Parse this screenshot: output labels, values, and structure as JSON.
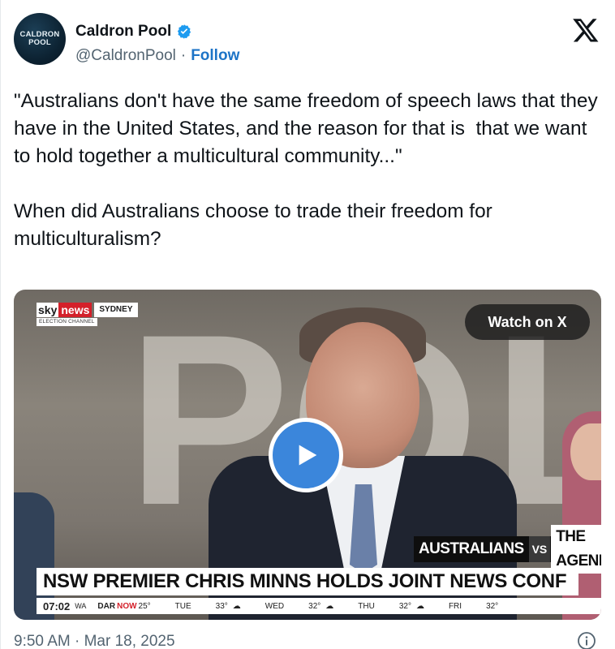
{
  "author": {
    "avatar_line1": "CALDRON",
    "avatar_line2": "POOL",
    "name": "Caldron Pool",
    "handle": "@CaldronPool",
    "separator": "·",
    "follow_label": "Follow"
  },
  "icons": {
    "verified": "verified-badge-icon",
    "platform": "x-logo-icon",
    "play": "play-icon",
    "info": "info-icon"
  },
  "colors": {
    "verified": "#1d9bf0",
    "follow": "#1d74c7",
    "play": "#3b86db",
    "breaking_red": "#d4202a"
  },
  "tweet": {
    "text": "\"Australians don't have the same freedom of speech laws that they have in the United States, and the reason for that is  that we want to hold together a multicultural community...\"\n\nWhen did Australians choose to trade their freedom for multiculturalism?"
  },
  "media": {
    "watch_label": "Watch on X",
    "wall_letters": [
      "P",
      "O",
      "L"
    ],
    "channel": {
      "sky": "sky",
      "news": "news",
      "location": "SYDNEY",
      "sub": "ELECTION CHANNEL"
    },
    "program": {
      "left": "AUSTRALIANS",
      "vs": "VS",
      "right": "THE AGENDA"
    },
    "headline": "NSW PREMIER CHRIS MINNS HOLDS JOINT NEWS CONF",
    "ticker": {
      "time": "07:02",
      "zone": "WA",
      "city": "DAR",
      "now": "NOW",
      "now_temp": "25°",
      "days": [
        {
          "day": "TUE",
          "temp": "33°"
        },
        {
          "day": "WED",
          "temp": "32°"
        },
        {
          "day": "THU",
          "temp": "32°"
        },
        {
          "day": "FRI",
          "temp": "32°"
        }
      ]
    }
  },
  "footer": {
    "timestamp": "9:50 AM · Mar 18, 2025"
  }
}
